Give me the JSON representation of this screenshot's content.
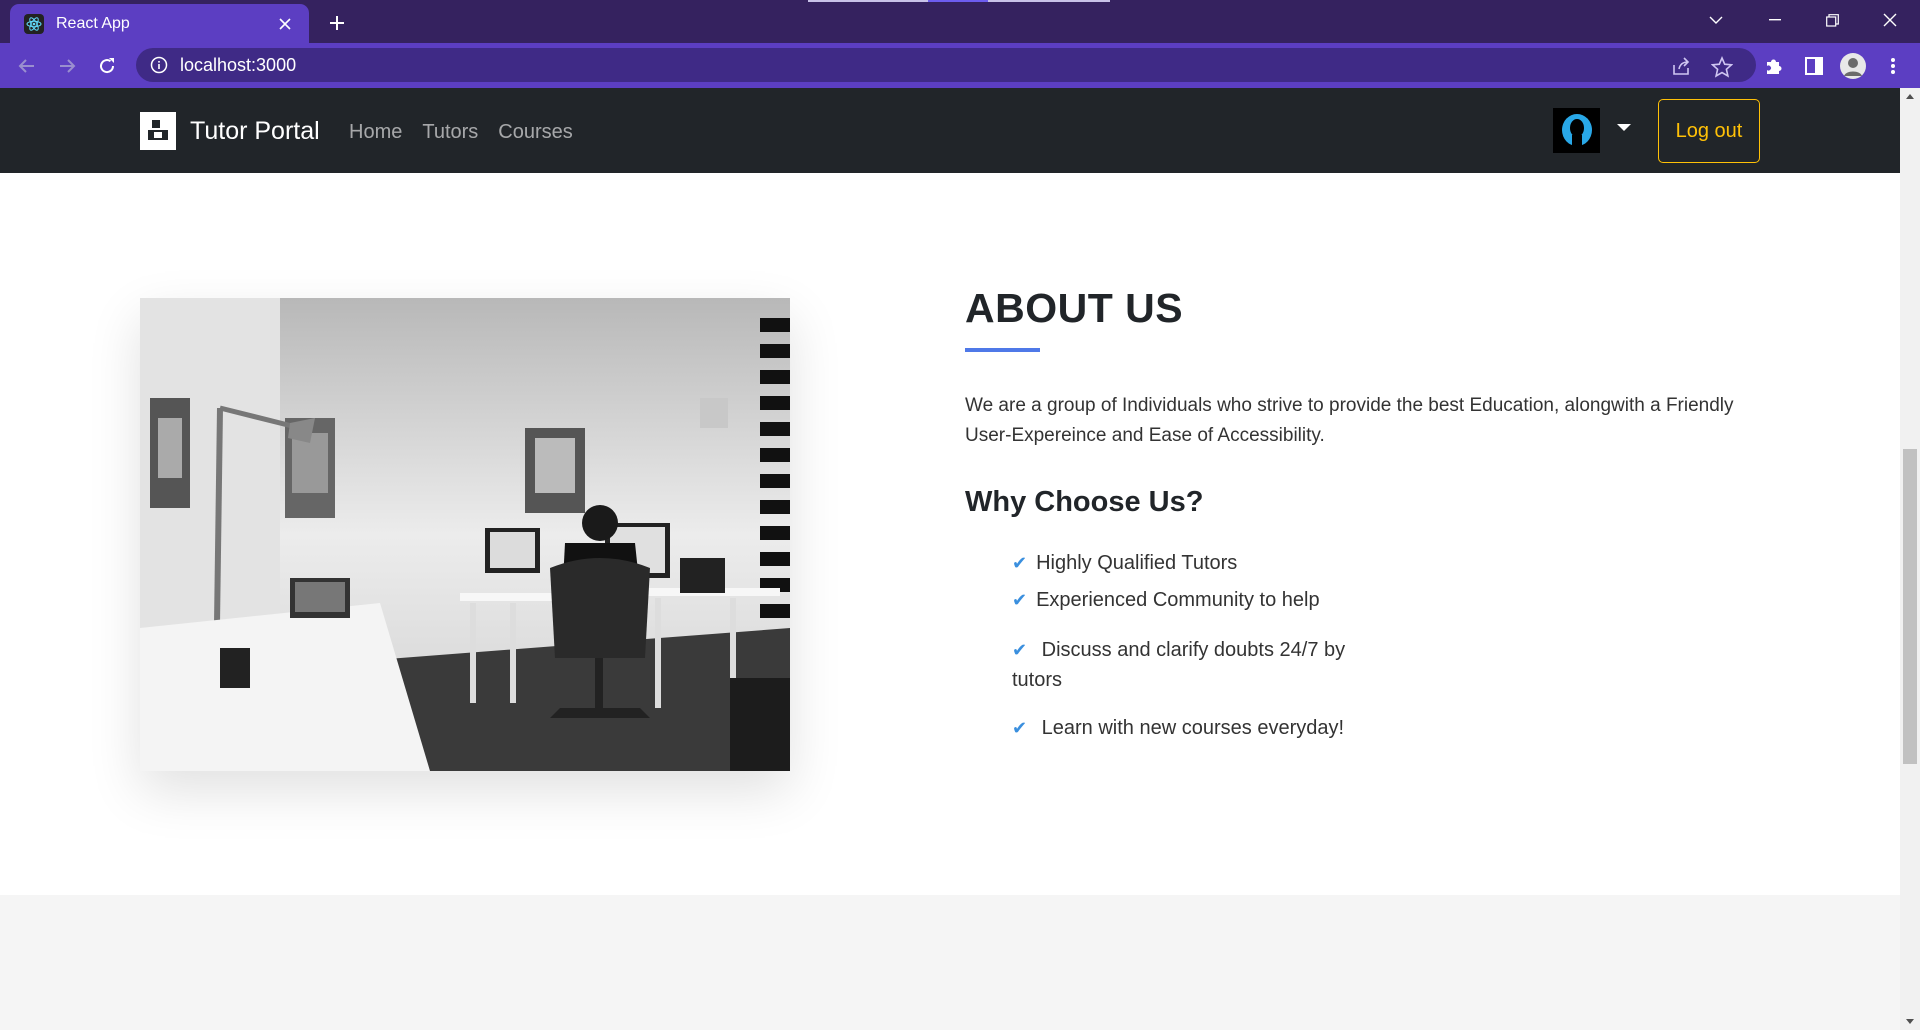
{
  "browser": {
    "tab_title": "React App",
    "url": "localhost:3000",
    "icons": [
      "react-favicon",
      "close-icon",
      "plus-icon",
      "chevron-down-icon",
      "minimize-icon",
      "restore-icon",
      "close-window-icon",
      "back-arrow-icon",
      "forward-arrow-icon",
      "reload-icon",
      "info-icon",
      "share-icon",
      "star-icon",
      "puzzle-icon",
      "side-panel-icon",
      "profile-avatar",
      "kebab-menu-icon"
    ]
  },
  "navbar": {
    "brand": "Tutor Portal",
    "links": [
      "Home",
      "Tutors",
      "Courses"
    ],
    "logout_label": "Log out"
  },
  "about": {
    "title": "ABOUT US",
    "description": "We are a group of Individuals who strive to provide the best Education, alongwith a Friendly User-Expereince and Ease of Accessibility.",
    "why_title": "Why Choose Us?",
    "features": [
      "Highly Qualified Tutors",
      "Experienced Community to help",
      "Discuss and clarify doubts 24/7 by tutors",
      "Learn with new courses everyday!"
    ]
  },
  "colors": {
    "tabstrip": "#35225f",
    "toolbar": "#5c3ec2",
    "navbar": "#212529",
    "accent_underline": "#4f79e8",
    "logout_border": "#ffc107",
    "check": "#3a8fde"
  }
}
